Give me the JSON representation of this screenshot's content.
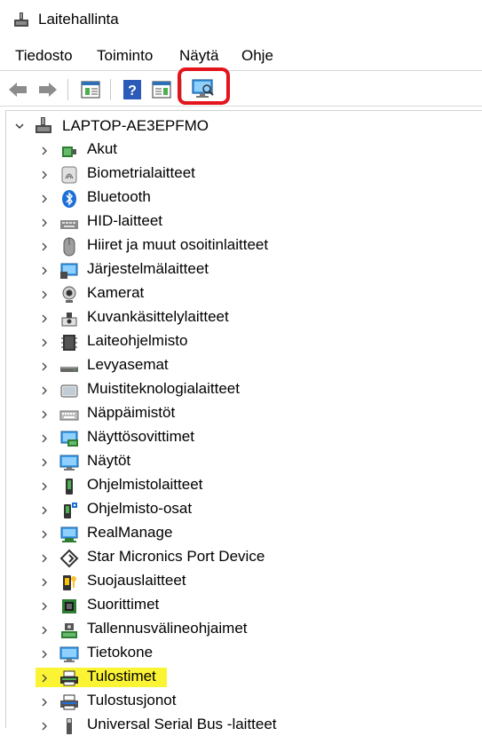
{
  "window": {
    "title": "Laitehallinta"
  },
  "menu": [
    {
      "label": "Tiedosto"
    },
    {
      "label": "Toiminto"
    },
    {
      "label": "Näytä"
    },
    {
      "label": "Ohje"
    }
  ],
  "toolbar": {
    "buttons": [
      {
        "icon": "back-arrow-icon"
      },
      {
        "icon": "forward-arrow-icon"
      },
      {
        "icon": "properties-icon"
      },
      {
        "icon": "help-icon"
      },
      {
        "icon": "update-driver-icon"
      },
      {
        "icon": "scan-hardware-icon",
        "highlighted": true
      }
    ],
    "highlight_color": "#e3141b"
  },
  "tree": {
    "root": {
      "label": "LAPTOP-AE3EPFMO",
      "expanded": true,
      "icon": "computer-icon"
    },
    "items": [
      {
        "label": "Akut",
        "icon": "battery-icon"
      },
      {
        "label": "Biometrialaitteet",
        "icon": "fingerprint-icon"
      },
      {
        "label": "Bluetooth",
        "icon": "bluetooth-icon"
      },
      {
        "label": "HID-laitteet",
        "icon": "hid-icon"
      },
      {
        "label": "Hiiret ja muut osoitinlaitteet",
        "icon": "mouse-icon"
      },
      {
        "label": "Järjestelmälaitteet",
        "icon": "system-devices-icon"
      },
      {
        "label": "Kamerat",
        "icon": "camera-icon"
      },
      {
        "label": "Kuvankäsittelylaitteet",
        "icon": "imaging-device-icon"
      },
      {
        "label": "Laiteohjelmisto",
        "icon": "firmware-icon"
      },
      {
        "label": "Levyasemat",
        "icon": "disk-drive-icon"
      },
      {
        "label": "Muistiteknologialaitteet",
        "icon": "memory-tech-icon"
      },
      {
        "label": "Näppäimistöt",
        "icon": "keyboard-icon"
      },
      {
        "label": "Näyttösovittimet",
        "icon": "display-adapter-icon"
      },
      {
        "label": "Näytöt",
        "icon": "monitor-icon"
      },
      {
        "label": "Ohjelmistolaitteet",
        "icon": "software-device-icon"
      },
      {
        "label": "Ohjelmisto-osat",
        "icon": "software-component-icon"
      },
      {
        "label": "RealManage",
        "icon": "realmanage-icon"
      },
      {
        "label": "Star Micronics Port Device",
        "icon": "port-device-icon"
      },
      {
        "label": "Suojauslaitteet",
        "icon": "security-device-icon"
      },
      {
        "label": "Suorittimet",
        "icon": "processor-icon"
      },
      {
        "label": "Tallennusvälineohjaimet",
        "icon": "storage-controller-icon"
      },
      {
        "label": "Tietokone",
        "icon": "computer-monitor-icon"
      },
      {
        "label": "Tulostimet",
        "icon": "printer-icon",
        "highlighted": true
      },
      {
        "label": "Tulostusjonot",
        "icon": "print-queue-icon"
      },
      {
        "label": "Universal Serial Bus -laitteet",
        "icon": "usb-icon"
      }
    ],
    "highlight_color": "#fbf434"
  }
}
